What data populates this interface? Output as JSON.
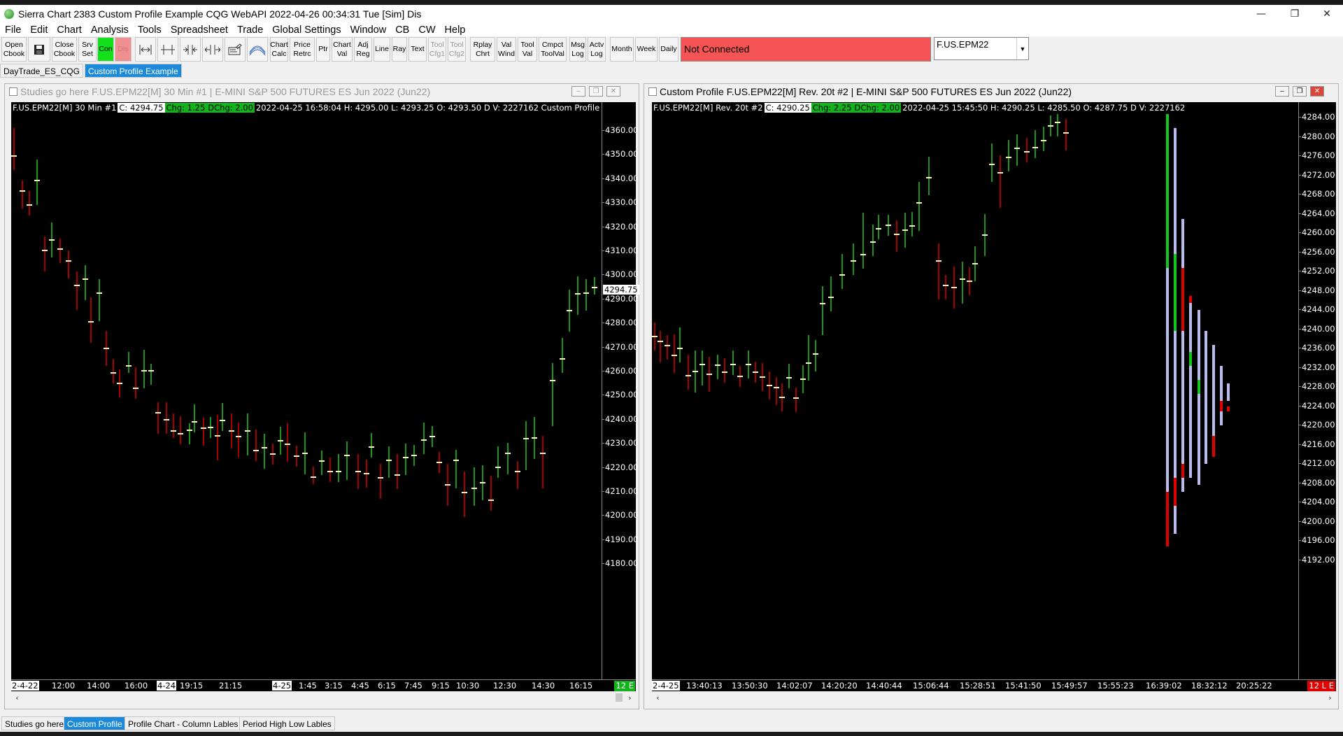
{
  "window": {
    "title": "Sierra Chart 2383 Custom Profile Example  CQG WebAPI 2022-04-26  00:34:31 Tue [Sim]  Dis",
    "minimize": "—",
    "maximize": "❐",
    "close": "✕"
  },
  "menu": [
    "File",
    "Edit",
    "Chart",
    "Analysis",
    "Tools",
    "Spreadsheet",
    "Trade",
    "Global Settings",
    "Window",
    "CB",
    "CW",
    "Help"
  ],
  "toolbar": {
    "buttons": [
      {
        "label": "Open\nCbook"
      },
      {
        "label": "save-icon",
        "icon": "save-icon"
      },
      {
        "label": "Close\nCbook"
      },
      {
        "label": "Srv\nSet"
      },
      {
        "label": "Con"
      },
      {
        "label": "Dis"
      },
      {
        "label": "zoom-in-icon"
      },
      {
        "label": "zoom-out-icon"
      },
      {
        "label": "scale-in-icon"
      },
      {
        "label": "scale-out-icon"
      },
      {
        "label": "chart-settings-icon"
      },
      {
        "label": "studies-icon"
      },
      {
        "label": "Chart\nCalc"
      },
      {
        "label": "Price\nRetrc"
      },
      {
        "label": "Ptr"
      },
      {
        "label": "Chart\nVal"
      },
      {
        "label": "Adj\nReg"
      },
      {
        "label": "Line"
      },
      {
        "label": "Ray"
      },
      {
        "label": "Text"
      },
      {
        "label": "Tool\nCfg1"
      },
      {
        "label": "Tool\nCfg2"
      },
      {
        "label": "Rplay\nChrt"
      },
      {
        "label": "Val\nWind"
      },
      {
        "label": "Tool\nVal"
      },
      {
        "label": "Cmpct\nToolVal"
      },
      {
        "label": "Msg\nLog"
      },
      {
        "label": "Actv\nLog"
      },
      {
        "label": "Month"
      },
      {
        "label": "Week"
      },
      {
        "label": "Daily"
      }
    ],
    "status": "Not Connected",
    "symbol": "F.US.EPM22",
    "colors": {
      "status_bg": "#f45454",
      "con_bg": "#11e01b",
      "dis_bg": "#ef8f8f"
    }
  },
  "chartbook_tabs": [
    {
      "label": "DayTrade_ES_CQG",
      "active": false
    },
    {
      "label": "Custom Profile Example",
      "active": true
    }
  ],
  "left_chart": {
    "window_title": "Studies go here F.US.EPM22[M]  30 Min   #1 | E-MINI S&P 500 FUTURES ES Jun 2022 (Jun22)",
    "symbol_label": "F.US.EPM22[M]  30 Min   #1",
    "close": "C: 4294.75",
    "chg": "Chg: 1.25",
    "dchg": "DChg: 2.00",
    "info": "2022-04-25 16:58:04 H: 4295.00 L: 4293.25 O: 4293.50 D V: 2227162 Custom Profile",
    "price_label": "4294.75",
    "badge": "12 E",
    "y_ticks": [
      "4360.00",
      "4350.00",
      "4340.00",
      "4330.00",
      "4320.00",
      "4310.00",
      "4300.00",
      "4290.00",
      "4280.00",
      "4270.00",
      "4260.00",
      "4250.00",
      "4240.00",
      "4230.00",
      "4220.00",
      "4210.00",
      "4200.00",
      "4190.00",
      "4180.00"
    ],
    "x_ticks": [
      "2-4-22",
      "12:00",
      "14:00",
      "16:00",
      "4-24",
      "19:15",
      "21:15",
      "4-25",
      "1:45",
      "3:15",
      "4:45",
      "6:15",
      "7:45",
      "9:15",
      "10:30",
      "12:30",
      "14:30",
      "16:15"
    ]
  },
  "right_chart": {
    "window_title": "Custom Profile F.US.EPM22[M]  Rev. 20t  #2 | E-MINI S&P 500 FUTURES ES Jun 2022 (Jun22)",
    "symbol_label": "F.US.EPM22[M]  Rev. 20t  #2",
    "close": "C: 4290.25",
    "chg": "Chg: 2.25",
    "dchg": "DChg: 2.00",
    "info": "2022-04-25 15:45:50 H: 4290.25 L: 4285.50 O: 4287.75 D V: 2227162",
    "badge": "12 L E",
    "y_ticks": [
      "4284.00",
      "4280.00",
      "4276.00",
      "4272.00",
      "4268.00",
      "4264.00",
      "4260.00",
      "4256.00",
      "4252.00",
      "4248.00",
      "4244.00",
      "4240.00",
      "4236.00",
      "4232.00",
      "4228.00",
      "4224.00",
      "4220.00",
      "4216.00",
      "4212.00",
      "4208.00",
      "4204.00",
      "4200.00",
      "4196.00",
      "4192.00"
    ],
    "x_ticks": [
      "2-4-25",
      "13:40:13",
      "13:50:30",
      "14:02:07",
      "14:20:20",
      "14:40:44",
      "15:06:44",
      "15:28:51",
      "15:41:50",
      "15:49:57",
      "15:55:23",
      "16:39:02",
      "18:32:12",
      "20:25:22"
    ]
  },
  "bottom_tabs": [
    {
      "label": "Studies go here",
      "active": false
    },
    {
      "label": "Custom Profile",
      "active": true
    },
    {
      "label": "Profile Chart - Column Lables",
      "active": false
    },
    {
      "label": "Period High Low Lables",
      "active": false
    }
  ]
}
